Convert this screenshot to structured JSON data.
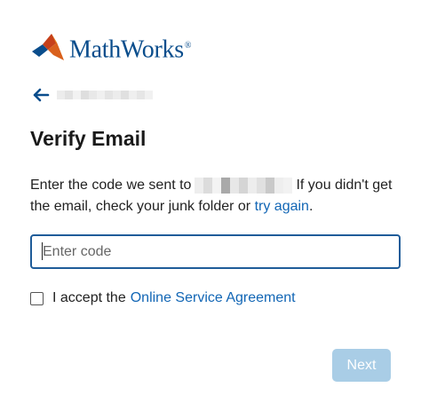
{
  "brand": {
    "name": "MathWorks",
    "registered_mark": "®",
    "colors": {
      "text": "#0a4d8c",
      "logo_red": "#c6401a",
      "logo_orange": "#e6861e",
      "logo_blue": "#0a4d8c"
    }
  },
  "back": {
    "icon": "arrow-left-icon"
  },
  "page": {
    "title": "Verify Email",
    "description_before": "Enter the code we sent to",
    "description_after": "If you didn't get the email, check your junk folder or",
    "try_again_label": "try again",
    "trailing_period": "."
  },
  "code_field": {
    "placeholder": "Enter code",
    "value": ""
  },
  "agreement": {
    "checked": false,
    "prefix": "I accept the",
    "link_label": "Online Service Agreement"
  },
  "actions": {
    "next_label": "Next",
    "next_enabled": false,
    "next_color": "#a9cde6"
  },
  "colors": {
    "link": "#1266b5",
    "input_border": "#1f5c99"
  }
}
